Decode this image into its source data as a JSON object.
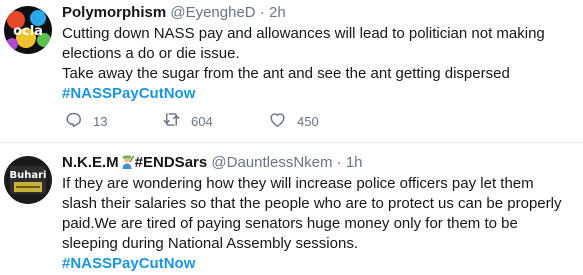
{
  "tweets": [
    {
      "display_name": "Polymorphism",
      "handle": "@EyengheD",
      "separator": "·",
      "time": "2h",
      "lines": [
        "Cutting down NASS pay and allowances will lead to politician not making",
        "elections a do or die issue.",
        "Take away the sugar from the ant and see the ant getting dispersed"
      ],
      "hashtag": "#NASSPayCutNow",
      "replies": "13",
      "retweets": "604",
      "likes": "450",
      "avatar_text": "ocla"
    },
    {
      "display_name_prefix": "N.K.E.M",
      "display_name_suffix": "#ENDSars",
      "emoji": "woman-farmer-emoji",
      "handle": "@DauntlessNkem",
      "separator": "·",
      "time": "1h",
      "lines": [
        "If they are wondering how they will increase police officers pay let them",
        "slash their salaries so that the people who are to protect us can be properly",
        "paid.We are tired of paying senators huge money only for them to be",
        "sleeping during National Assembly sessions."
      ],
      "hashtag": "#NASSPayCutNow",
      "avatar_text": "Buhari"
    }
  ],
  "colors": {
    "text": "#14171a",
    "secondary": "#657786",
    "hashtag": "#1b95e0",
    "divider": "#e6ecf0"
  },
  "icons": [
    "reply-icon",
    "retweet-icon",
    "like-icon"
  ]
}
